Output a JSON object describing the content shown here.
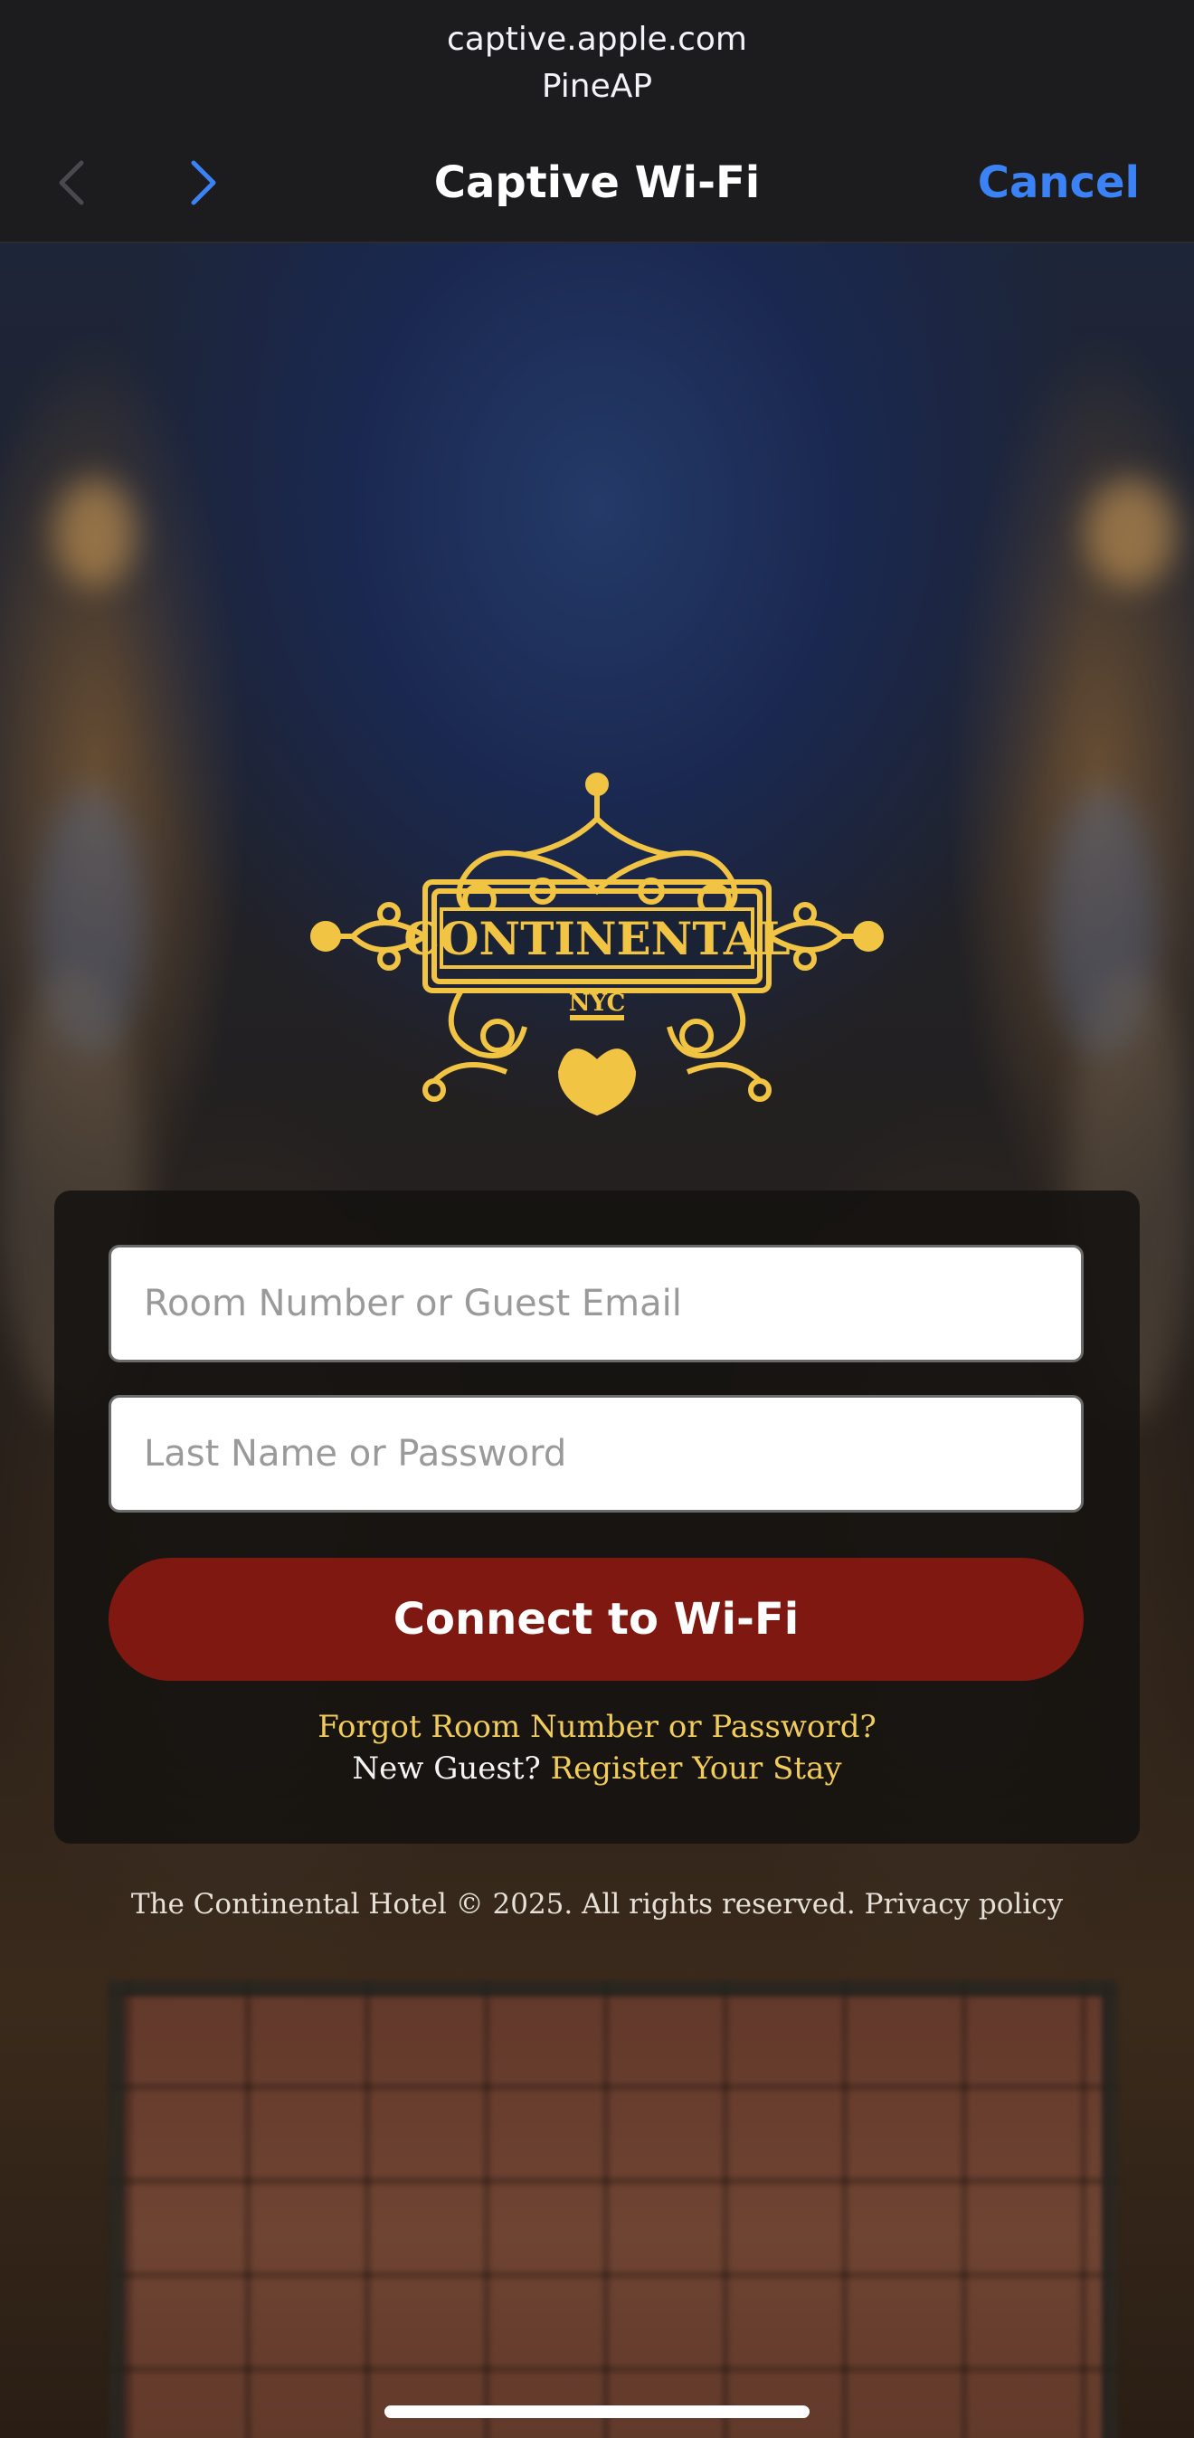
{
  "browser": {
    "host": "captive.apple.com",
    "ssid": "PineAP",
    "title": "Captive Wi-Fi",
    "cancel_label": "Cancel",
    "accent": "#3b82f6"
  },
  "logo": {
    "name": "CONTINENTAL",
    "subtitle": "NYC",
    "color": "#f2c443"
  },
  "form": {
    "room_placeholder": "Room Number or Guest Email",
    "password_placeholder": "Last Name or Password",
    "connect_label": "Connect to Wi-Fi",
    "connect_color": "#7f1810",
    "forgot_link": "Forgot Room Number or Password?",
    "new_guest_text": "New Guest?",
    "register_link": "Register Your Stay"
  },
  "footer": {
    "copyright": "The Continental Hotel © 2025. All rights reserved.",
    "privacy_link": "Privacy policy"
  }
}
